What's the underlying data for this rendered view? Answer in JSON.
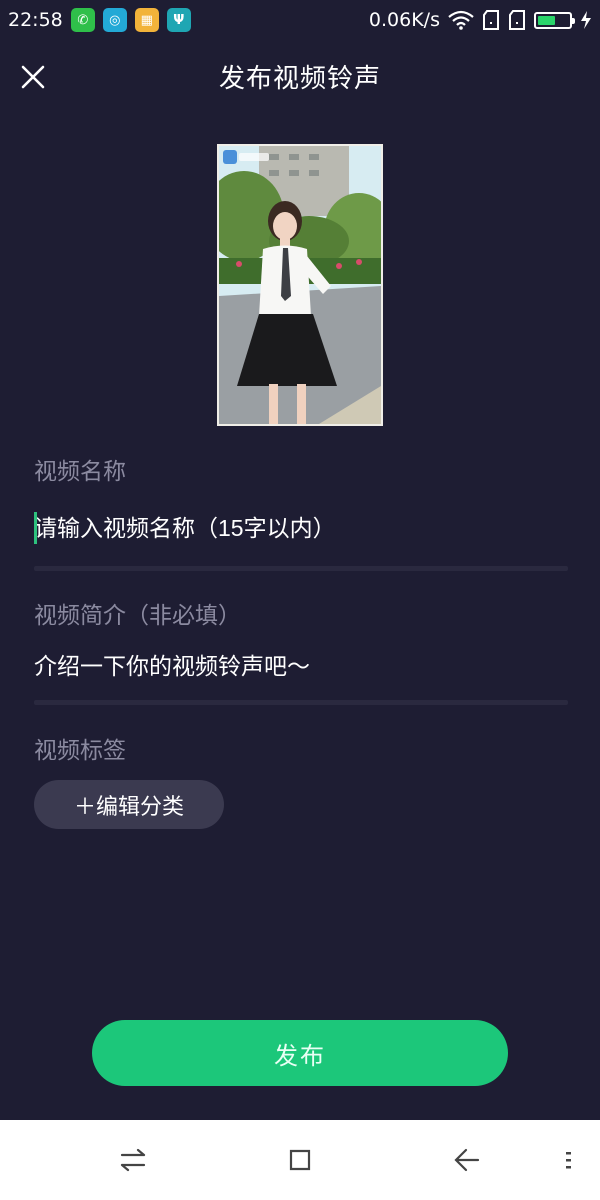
{
  "status_bar": {
    "time": "22:58",
    "net_speed": "0.06K/s",
    "app_icons": [
      "wechat-icon",
      "browser-icon",
      "gallery-icon",
      "usb-icon"
    ],
    "battery_level": 0.55
  },
  "header": {
    "title": "发布视频铃声",
    "close_icon": "close-icon"
  },
  "video_name": {
    "label": "视频名称",
    "placeholder": "请输入视频名称（15字以内）"
  },
  "video_desc": {
    "label": "视频简介（非必填）",
    "placeholder": "介绍一下你的视频铃声吧～"
  },
  "video_tags": {
    "label": "视频标签",
    "edit_button": "＋编辑分类"
  },
  "publish_button": "发布",
  "colors": {
    "background": "#1e1d33",
    "accent": "#1cc77a",
    "label": "#8b8aa0",
    "tag_button_bg": "#3b3a50"
  }
}
